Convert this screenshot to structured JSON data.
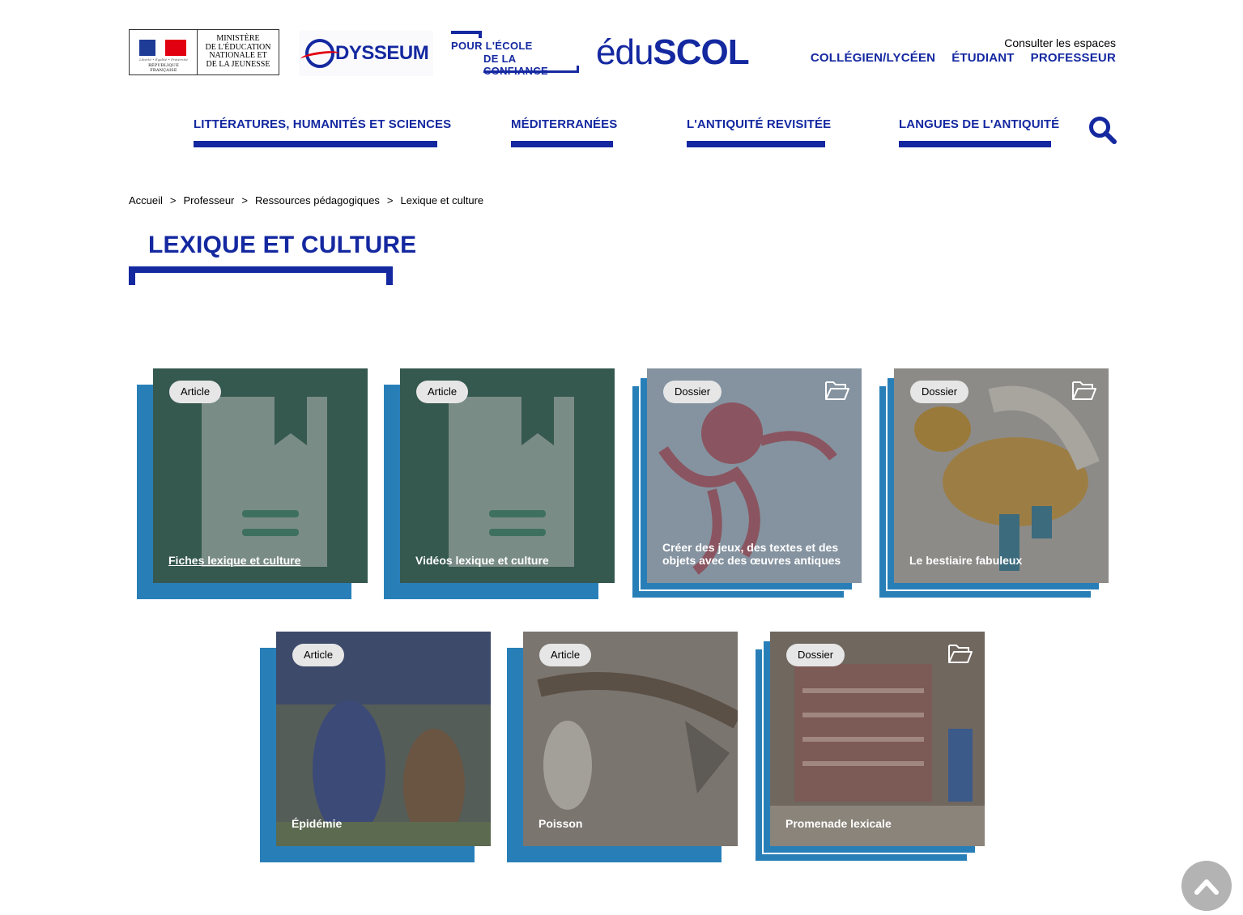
{
  "header": {
    "ministry": {
      "line1": "Ministère",
      "line2": "de l'Éducation",
      "line3": "nationale et",
      "line4": "de la Jeunesse",
      "motto": "Liberté • Égalité • Fraternité",
      "republic": "RÉPUBLIQUE FRANÇAISE"
    },
    "odysseum_logo": "DYSSEUM",
    "confiance_logo": {
      "line1": "POUR L'ÉCOLE",
      "line2": "DE LA CONFIANCE"
    },
    "eduscol_logo": {
      "part1": "édu",
      "part2": "SCOL"
    },
    "consult_label": "Consulter les espaces",
    "spaces": [
      {
        "label": "COLLÉGIEN/LYCÉEN"
      },
      {
        "label": "ÉTUDIANT"
      },
      {
        "label": "PROFESSEUR"
      }
    ]
  },
  "nav": {
    "items": [
      {
        "label": "LITTÉRATURES, HUMANITÉS ET SCIENCES"
      },
      {
        "label": "MÉDITERRANÉES"
      },
      {
        "label": "L'ANTIQUITÉ REVISITÉE"
      },
      {
        "label": "LANGUES DE L'ANTIQUITÉ"
      }
    ],
    "search_icon": "search-icon"
  },
  "breadcrumb": {
    "items": [
      "Accueil",
      "Professeur",
      "Ressources pédagogiques",
      "Lexique et culture"
    ],
    "separator": ">"
  },
  "page": {
    "title": "LEXIQUE ET CULTURE"
  },
  "cards": [
    {
      "type": "Article",
      "title": "Fiches lexique et culture"
    },
    {
      "type": "Article",
      "title": "Vidéos lexique et culture"
    },
    {
      "type": "Dossier",
      "title": "Créer des jeux, des textes et des objets avec des œuvres antiques"
    },
    {
      "type": "Dossier",
      "title": "Le bestiaire fabuleux"
    },
    {
      "type": "Article",
      "title": "Épidémie"
    },
    {
      "type": "Article",
      "title": "Poisson"
    },
    {
      "type": "Dossier",
      "title": "Promenade lexicale"
    }
  ],
  "colors": {
    "brand_blue": "#1428a0",
    "card_shadow": "#287fb8",
    "badge_bg": "#e6e6e6"
  },
  "scroll_top_icon": "chevron-up-icon"
}
